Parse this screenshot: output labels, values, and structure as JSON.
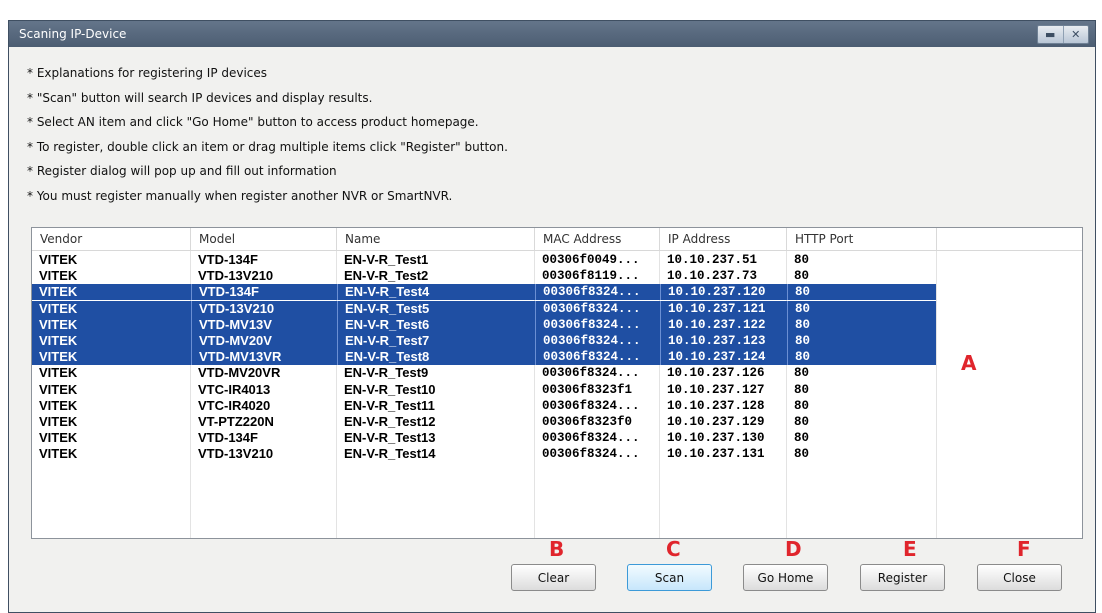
{
  "window": {
    "title": "Scaning IP-Device"
  },
  "instructions": [
    "* Explanations for registering IP devices",
    "* \"Scan\" button will search IP devices and display results.",
    "* Select AN item and click \"Go Home\" button to access product homepage.",
    "* To register, double click an item or drag multiple items click \"Register\" button.",
    "* Register dialog will pop up and fill out information",
    "* You must register manually when register another NVR or SmartNVR."
  ],
  "table": {
    "columns": [
      "Vendor",
      "Model",
      "Name",
      "MAC Address",
      "IP Address",
      "HTTP Port"
    ],
    "rows": [
      {
        "vendor": "VITEK",
        "model": "VTD-134F",
        "name": "EN-V-R_Test1",
        "mac": "00306f0049...",
        "ip": "10.10.237.51",
        "port": "80",
        "selected": false
      },
      {
        "vendor": "VITEK",
        "model": "VTD-13V210",
        "name": "EN-V-R_Test2",
        "mac": "00306f8119...",
        "ip": "10.10.237.73",
        "port": "80",
        "selected": false
      },
      {
        "vendor": "VITEK",
        "model": "VTD-134F",
        "name": "EN-V-R_Test4",
        "mac": "00306f8324...",
        "ip": "10.10.237.120",
        "port": "80",
        "selected": true
      },
      {
        "vendor": "VITEK",
        "model": "VTD-13V210",
        "name": "EN-V-R_Test5",
        "mac": "00306f8324...",
        "ip": "10.10.237.121",
        "port": "80",
        "selected": true
      },
      {
        "vendor": "VITEK",
        "model": "VTD-MV13V",
        "name": "EN-V-R_Test6",
        "mac": "00306f8324...",
        "ip": "10.10.237.122",
        "port": "80",
        "selected": true
      },
      {
        "vendor": "VITEK",
        "model": "VTD-MV20V",
        "name": "EN-V-R_Test7",
        "mac": "00306f8324...",
        "ip": "10.10.237.123",
        "port": "80",
        "selected": true
      },
      {
        "vendor": "VITEK",
        "model": "VTD-MV13VR",
        "name": "EN-V-R_Test8",
        "mac": "00306f8324...",
        "ip": "10.10.237.124",
        "port": "80",
        "selected": true
      },
      {
        "vendor": "VITEK",
        "model": "VTD-MV20VR",
        "name": "EN-V-R_Test9",
        "mac": "00306f8324...",
        "ip": "10.10.237.126",
        "port": "80",
        "selected": false
      },
      {
        "vendor": "VITEK",
        "model": "VTC-IR4013",
        "name": "EN-V-R_Test10",
        "mac": "00306f8323f1",
        "ip": "10.10.237.127",
        "port": "80",
        "selected": false
      },
      {
        "vendor": "VITEK",
        "model": "VTC-IR4020",
        "name": "EN-V-R_Test11",
        "mac": "00306f8324...",
        "ip": "10.10.237.128",
        "port": "80",
        "selected": false
      },
      {
        "vendor": "VITEK",
        "model": "VT-PTZ220N",
        "name": "EN-V-R_Test12",
        "mac": "00306f8323f0",
        "ip": "10.10.237.129",
        "port": "80",
        "selected": false
      },
      {
        "vendor": "VITEK",
        "model": "VTD-134F",
        "name": "EN-V-R_Test13",
        "mac": "00306f8324...",
        "ip": "10.10.237.130",
        "port": "80",
        "selected": false
      },
      {
        "vendor": "VITEK",
        "model": "VTD-13V210",
        "name": "EN-V-R_Test14",
        "mac": "00306f8324...",
        "ip": "10.10.237.131",
        "port": "80",
        "selected": false
      }
    ]
  },
  "buttons": {
    "clear": "Clear",
    "scan": "Scan",
    "go_home": "Go Home",
    "register": "Register",
    "close": "Close"
  },
  "annotations": {
    "a": "A",
    "b": "B",
    "c": "C",
    "d": "D",
    "e": "E",
    "f": "F"
  },
  "colors": {
    "selection": "#1f4fa3",
    "annotation": "#e0252c",
    "title_bar": "#56677c"
  }
}
